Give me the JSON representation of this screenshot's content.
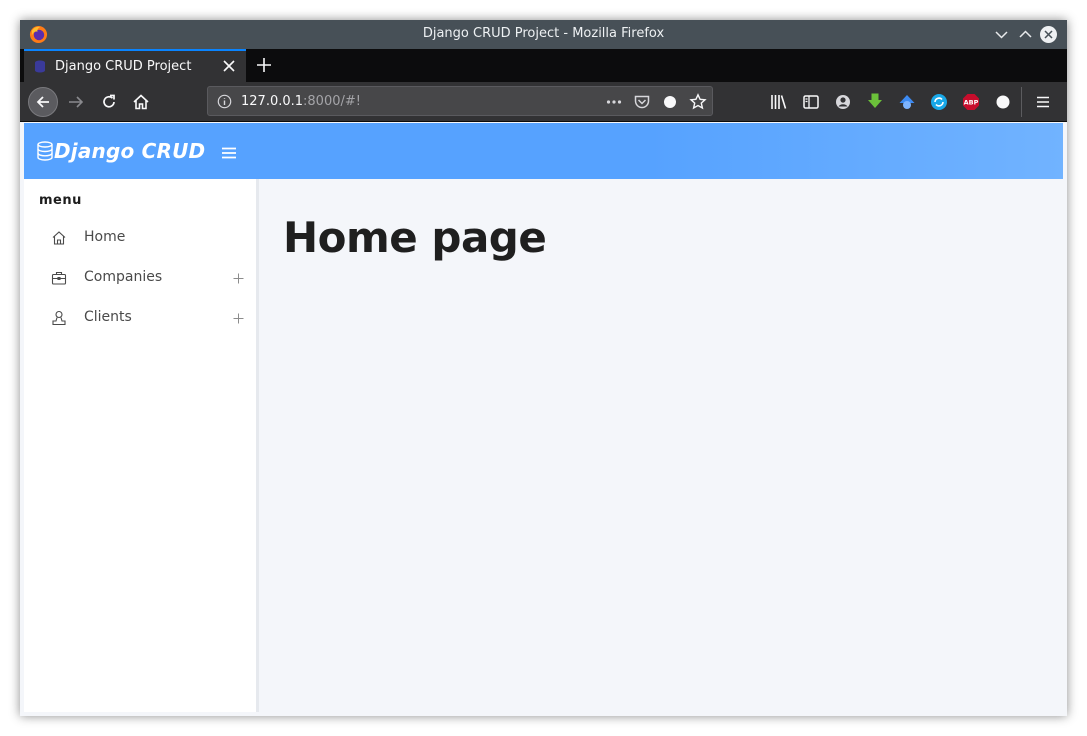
{
  "window": {
    "title": "Django CRUD Project - Mozilla Firefox"
  },
  "tabs": [
    {
      "label": "Django CRUD Project"
    }
  ],
  "urlbar": {
    "host": "127.0.0.1",
    "rest": ":8000/#!"
  },
  "app": {
    "brand": "Django CRUD",
    "menu_heading": "menu",
    "menu_items": [
      {
        "label": "Home",
        "icon": "home-icon",
        "expandable": false
      },
      {
        "label": "Companies",
        "icon": "briefcase-icon",
        "expandable": true
      },
      {
        "label": "Clients",
        "icon": "user-icon",
        "expandable": true
      }
    ],
    "page_title": "Home page"
  },
  "colors": {
    "header": "#56a2ff",
    "titlebar": "#475057",
    "tab_accent": "#0a84ff"
  }
}
